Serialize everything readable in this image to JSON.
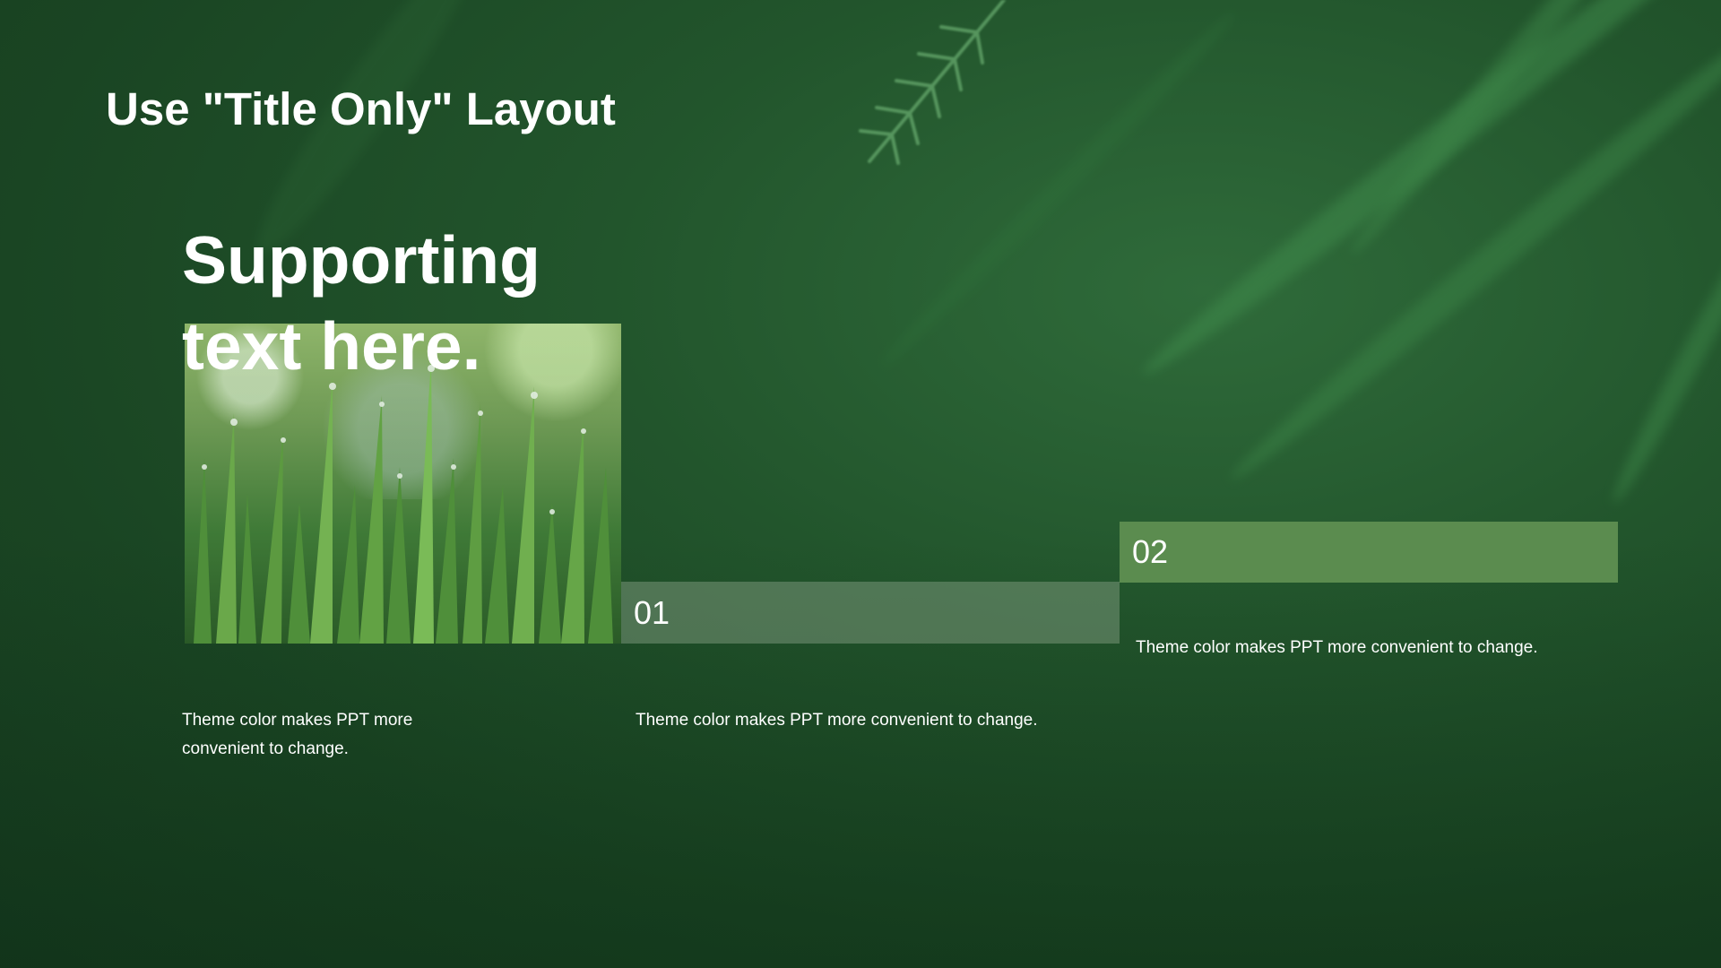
{
  "slide": {
    "title": "Use \"Title Only\" Layout",
    "supporting_text": "Supporting text here.",
    "image_description_icon": "grass-photo",
    "items": [
      {
        "number": "01",
        "description": "Theme color makes PPT more convenient to change."
      },
      {
        "number": "02",
        "description": "Theme color makes PPT more convenient to change."
      }
    ],
    "photo_caption": "Theme color makes PPT more convenient to change."
  },
  "colors": {
    "background": "#22552c",
    "accent_bar": "#5b8c4f",
    "muted_bar": "#6f8f6e",
    "text": "#ffffff"
  }
}
